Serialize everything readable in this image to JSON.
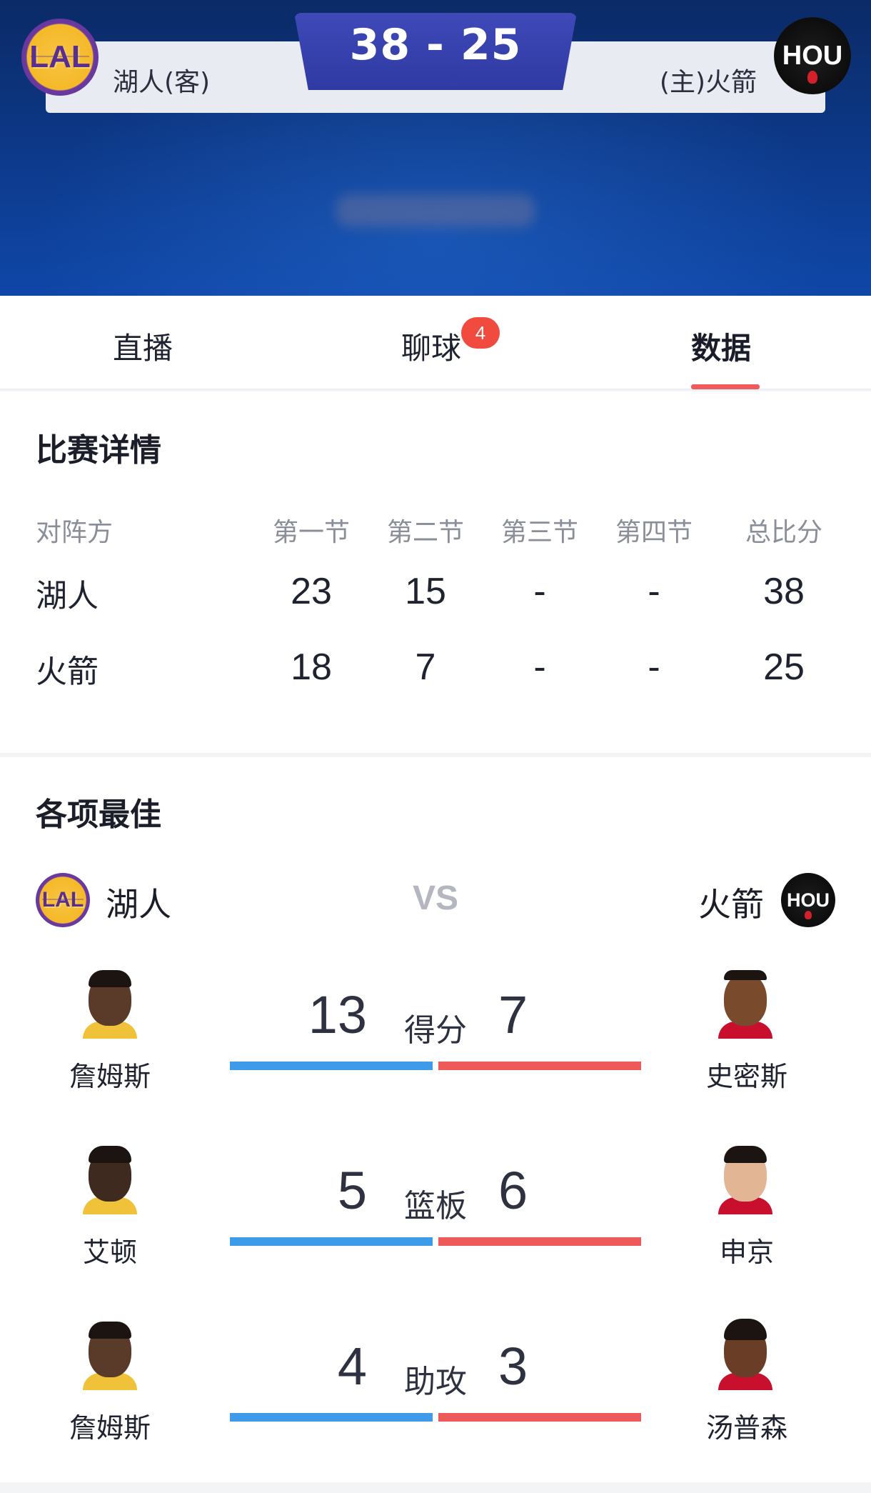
{
  "header": {
    "score": "38 - 25",
    "away_team_label": "湖人(客)",
    "home_team_label": "(主)火箭",
    "away_logo_text": "LAL",
    "home_logo_text": "HOU"
  },
  "tabs": {
    "live": "直播",
    "chat": "聊球",
    "chat_badge": "4",
    "data": "数据",
    "active": "数据"
  },
  "details": {
    "title": "比赛详情",
    "headers": [
      "对阵方",
      "第一节",
      "第二节",
      "第三节",
      "第四节",
      "总比分"
    ],
    "rows": [
      {
        "team": "湖人",
        "q": [
          "23",
          "15",
          "-",
          "-"
        ],
        "total": "38"
      },
      {
        "team": "火箭",
        "q": [
          "18",
          "7",
          "-",
          "-"
        ],
        "total": "25"
      }
    ]
  },
  "leaders": {
    "title": "各项最佳",
    "away_team": "湖人",
    "home_team": "火箭",
    "vs": "VS",
    "stats": [
      {
        "label": "得分",
        "away_value": "13",
        "home_value": "7",
        "away_player": "詹姆斯",
        "home_player": "史密斯"
      },
      {
        "label": "篮板",
        "away_value": "5",
        "home_value": "6",
        "away_player": "艾顿",
        "home_player": "申京"
      },
      {
        "label": "助攻",
        "away_value": "4",
        "home_value": "3",
        "away_player": "詹姆斯",
        "home_player": "汤普森"
      }
    ]
  },
  "colors": {
    "away_bar": "#3d9be9",
    "home_bar": "#ee5a5a",
    "score_tab": "#3a44b0",
    "badge": "#f14a3e",
    "hero_bg": "#0d3a8c"
  }
}
